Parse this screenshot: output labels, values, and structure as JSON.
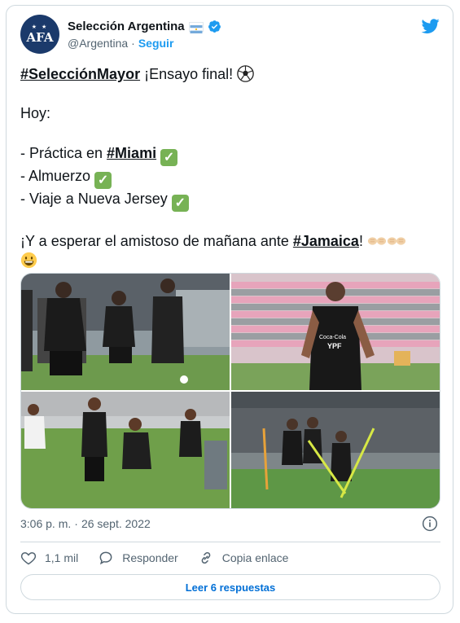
{
  "author": {
    "display_name": "Selección Argentina",
    "handle": "@Argentina",
    "separator": "·",
    "follow_label": "Seguir",
    "avatar_text": "AFA",
    "avatar_stars": "★ ★"
  },
  "tweet": {
    "line1_hashtag": "#SelecciónMayor",
    "line1_text": " ¡Ensayo final! ",
    "line2": "Hoy:",
    "item1_prefix": "- Práctica en ",
    "item1_hashtag": "#Miami",
    "item2": "- Almuerzo ",
    "item3": "- Viaje a Nueva Jersey ",
    "closing_prefix": "¡Y a esperar el amistoso de mañana ante ",
    "closing_hashtag": "#Jamaica",
    "closing_suffix": "! ",
    "check_glyph": "✓"
  },
  "meta": {
    "time": "3:06 p. m.",
    "separator": "·",
    "date": "26 sept. 2022"
  },
  "actions": {
    "like_count": "1,1 mil",
    "reply_label": "Responder",
    "copy_label": "Copia enlace"
  },
  "read_replies_label": "Leer 6 respuestas",
  "photo_texts": {
    "sponsor": "YPF",
    "brand": "Coca-Cola"
  },
  "icons": {
    "brand": "twitter-bird-icon",
    "verified": "verified-badge-icon",
    "flag": "argentina-flag-icon",
    "info": "info-icon",
    "like": "heart-icon",
    "reply": "reply-bubble-icon",
    "copy": "link-icon"
  },
  "colors": {
    "accent": "#1d9bf0",
    "link_button": "#006fd6",
    "muted": "#536471",
    "border": "#cfd9de",
    "check_green": "#77b255"
  }
}
